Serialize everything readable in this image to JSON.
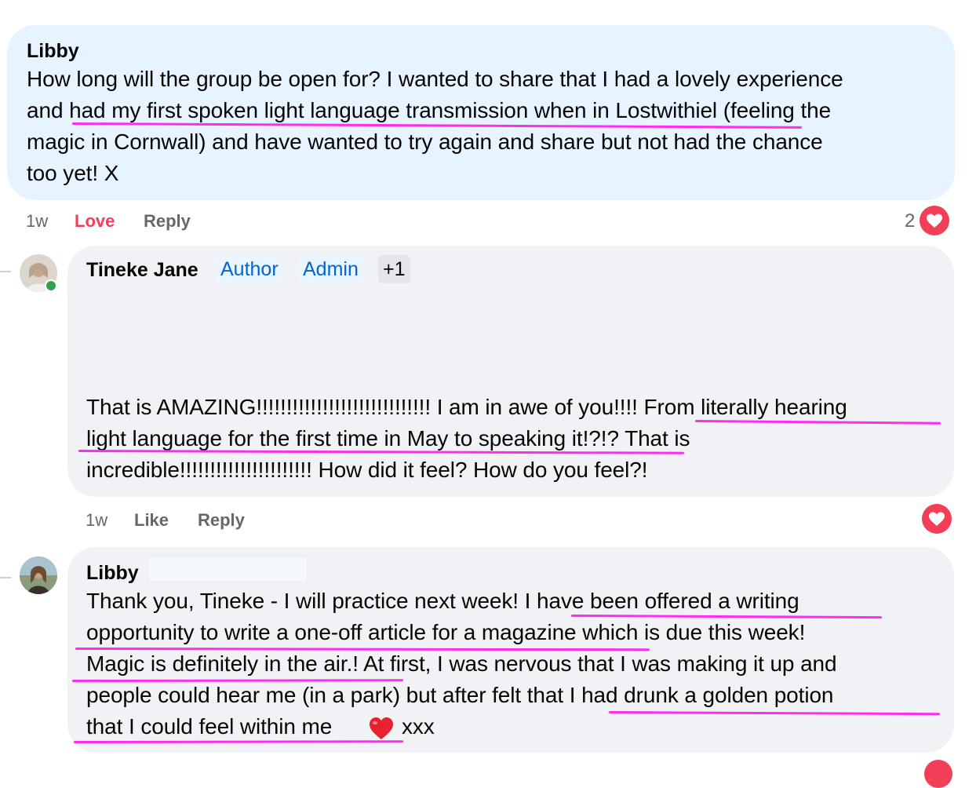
{
  "comment1": {
    "author": "Libby",
    "lines": [
      "How long will the group be open for? I wanted to share that I had a lovely experience",
      "and had my first spoken light language transmission when in Lostwithiel (feeling the",
      "magic in Cornwall) and have wanted to try again and share but not had the chance",
      "too yet! X"
    ],
    "time": "1w",
    "reaction_label": "Love",
    "reply_label": "Reply",
    "reaction_count": "2",
    "reaction_icon": "love-reaction-icon",
    "bubble_color": "#e7f3ff"
  },
  "comment2": {
    "author": "Tineke Jane",
    "badges": [
      "Author",
      "Admin",
      "+1"
    ],
    "lines": [
      "That is AMAZING!!!!!!!!!!!!!!!!!!!!!!!!!!!!! I am in awe of you!!!! From literally hearing",
      "light language for the first time in May to speaking it!?!? That is",
      "incredible!!!!!!!!!!!!!!!!!!!!!! How did it feel? How do you feel?!"
    ],
    "time": "1w",
    "like_label": "Like",
    "reply_label": "Reply",
    "reaction_icon": "love-reaction-icon",
    "bubble_color": "#f0f2f5"
  },
  "comment3": {
    "author": "Libby",
    "lines": [
      "Thank you, Tineke - I will practice next week! I have been offered a writing",
      "opportunity to write a one-off article for a magazine which is due this week!",
      "Magic is definitely in the air.! At first, I was nervous that I was making it up and",
      "people could hear me (in a park) but after felt that I had drunk a golden potion",
      "that I could feel within me",
      "xxx"
    ],
    "emoji": "❤️",
    "bubble_color": "#f0f2f5"
  },
  "colors": {
    "highlight": "#ff2cf0",
    "love": "#f33e58",
    "badge_text": "#0064d1",
    "meta_text": "#65676b"
  }
}
